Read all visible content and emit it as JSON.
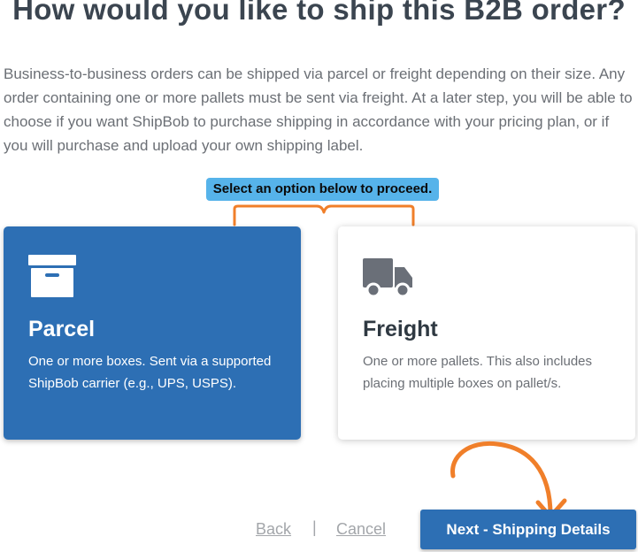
{
  "page": {
    "title": "How would you like to ship this B2B order?",
    "description": "Business-to-business orders can be shipped via parcel or freight depending on their size. Any order containing one or more pallets must be sent via freight. At a later step, you will be able to choose if you want ShipBob to purchase shipping in accordance with your pricing plan, or if you will purchase and upload your own shipping label.",
    "hint": "Select an option below to proceed."
  },
  "options": {
    "parcel": {
      "title": "Parcel",
      "description": "One or more boxes. Sent via a supported ShipBob carrier (e.g., UPS, USPS).",
      "icon": "archive-box-icon",
      "selected": true
    },
    "freight": {
      "title": "Freight",
      "description": "One or more pallets. This also includes placing multiple boxes on pallet/s.",
      "icon": "truck-icon",
      "selected": false
    }
  },
  "footer": {
    "back_label": "Back",
    "separator": "|",
    "cancel_label": "Cancel",
    "next_label": "Next - Shipping Details"
  },
  "colors": {
    "primary": "#2d6fb4",
    "highlight": "#56b3ea",
    "annotation": "#f07f2a",
    "heading": "#3b4550",
    "body_text": "#6b6f75"
  }
}
